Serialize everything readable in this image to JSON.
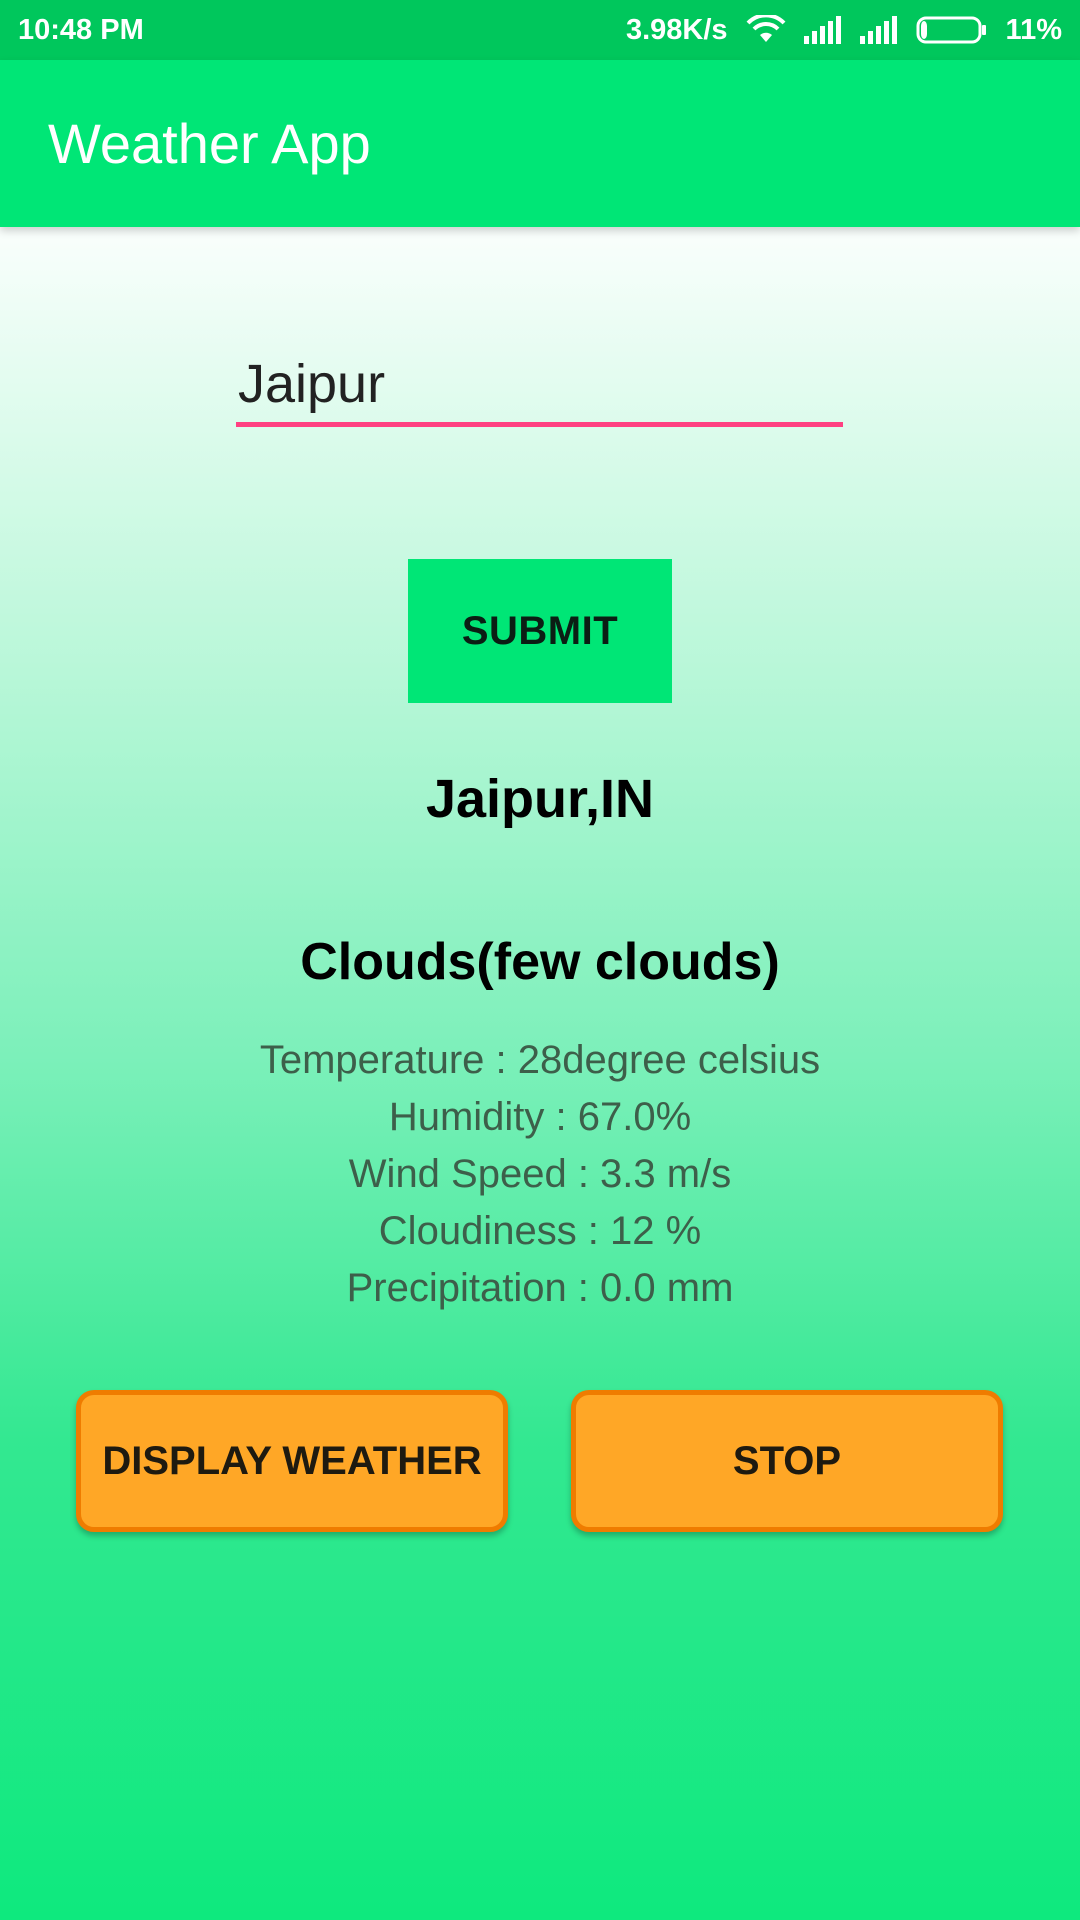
{
  "status_bar": {
    "time": "10:48 PM",
    "network_speed": "3.98K/s",
    "battery_percent": "11%",
    "battery_level": 0.11,
    "icons": [
      "wifi-icon",
      "signal-icon",
      "signal-icon",
      "battery-icon"
    ],
    "color": "#00c75c"
  },
  "app_bar": {
    "title": "Weather App",
    "color": "#00e676"
  },
  "search": {
    "value": "Jaipur",
    "underline_color": "#ff4081"
  },
  "submit": {
    "label": "SUBMIT"
  },
  "result": {
    "location": "Jaipur,IN",
    "condition": "Clouds(few clouds)",
    "temperature": "Temperature : 28degree celsius",
    "humidity": "Humidity : 67.0%",
    "wind_speed": "Wind Speed : 3.3 m/s",
    "cloudiness": "Cloudiness : 12 %",
    "precipitation": "Precipitation : 0.0 mm"
  },
  "actions": {
    "display_label": "DISPLAY WEATHER",
    "stop_label": "STOP",
    "color": "#ffa726",
    "border_color": "#ef7c00"
  }
}
